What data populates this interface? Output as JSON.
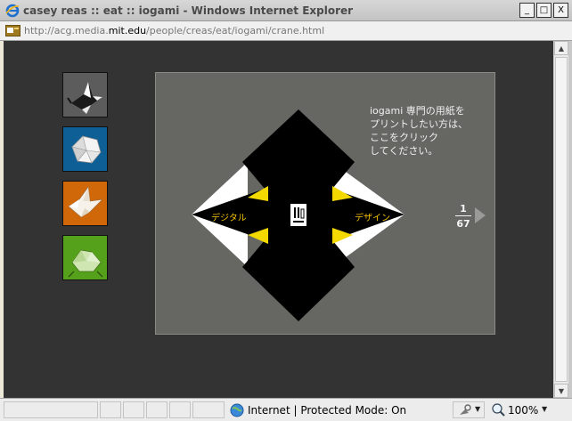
{
  "window": {
    "title": "casey reas :: eat :: iogami - Windows Internet Explorer",
    "minimize": "_",
    "maximize": "□",
    "close": "X"
  },
  "address": {
    "url_prefix": "http://acg.media.",
    "url_domain": "mit.edu",
    "url_suffix": "/people/creas/eat/iogami/crane.html"
  },
  "thumbnails": [
    {
      "name": "crane",
      "bg": "#5c5c5c"
    },
    {
      "name": "flower",
      "bg": "#0d5f96"
    },
    {
      "name": "bird",
      "bg": "#d0680a"
    },
    {
      "name": "frog",
      "bg": "#56a11b"
    }
  ],
  "panel": {
    "instructions": "iogami 専門の用紙を\nプリントしたい方は、\nここをクリック\nしてください。",
    "label_left": "デジタル",
    "label_right": "デザイン",
    "page_current": "1",
    "page_total": "67"
  },
  "status": {
    "zone_text": "Internet | Protected Mode: On",
    "zoom": "100%"
  },
  "colors": {
    "page_bg": "#333333",
    "panel_bg": "#666763",
    "accent_yellow": "#f3c000"
  }
}
